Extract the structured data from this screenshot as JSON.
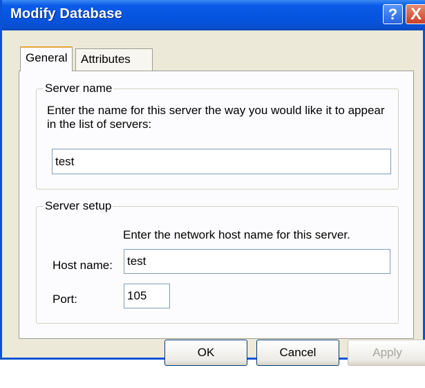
{
  "window": {
    "title": "Modify Database",
    "help": "?",
    "close": "X"
  },
  "tabs": [
    {
      "label": "General"
    },
    {
      "label": "Attributes"
    }
  ],
  "server_name": {
    "legend": "Server name",
    "description_line1": "Enter the name for this server the way you would like it to appear",
    "description_line2": "in the list of servers:",
    "value": "test"
  },
  "server_setup": {
    "legend": "Server setup",
    "description": "Enter the network host name for this server.",
    "host_label": "Host name:",
    "host_value": "test",
    "port_label": "Port:",
    "port_value": "105"
  },
  "buttons": {
    "ok": "OK",
    "cancel": "Cancel",
    "apply": "Apply"
  }
}
